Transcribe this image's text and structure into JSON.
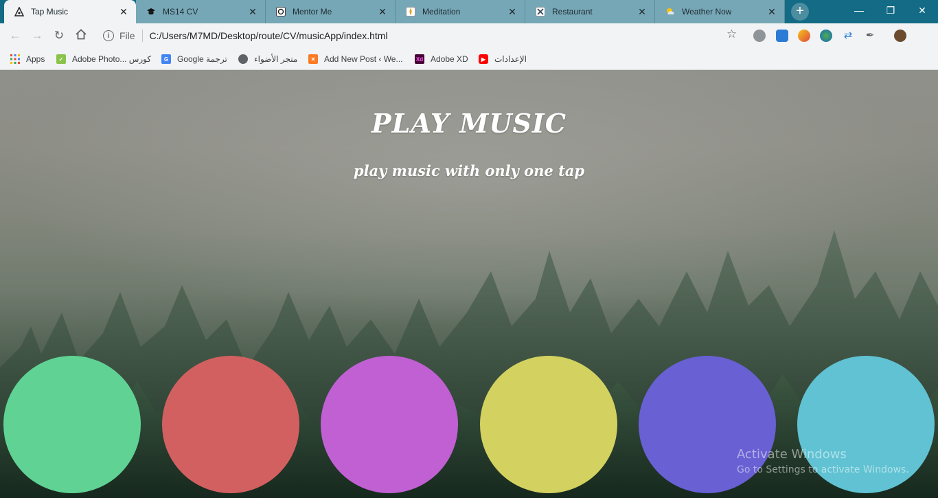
{
  "browser": {
    "tabs": [
      {
        "label": "Tap Music",
        "active": true,
        "icon": "music-app-icon"
      },
      {
        "label": "MS14 CV",
        "active": false,
        "icon": "graduation-cap-icon"
      },
      {
        "label": "Mentor Me",
        "active": false,
        "icon": "mentor-logo-icon"
      },
      {
        "label": "Meditation",
        "active": false,
        "icon": "meditation-icon"
      },
      {
        "label": "Restaurant",
        "active": false,
        "icon": "restaurant-icon"
      },
      {
        "label": "Weather Now",
        "active": false,
        "icon": "weather-icon"
      }
    ],
    "url_scheme": "File",
    "url": "C:/Users/M7MD/Desktop/route/CV/musicApp/index.html"
  },
  "bookmarks": [
    {
      "label": "Apps",
      "icon": "apps-grid-icon",
      "color": "#e8453c"
    },
    {
      "label": "Adobe Photo... كورس",
      "icon": "adobe-photoshop-icon",
      "color": "#8bc34a"
    },
    {
      "label": "Google ترجمة",
      "icon": "google-translate-icon",
      "color": "#4285f4"
    },
    {
      "label": "متجر الأضواء",
      "icon": "globe-icon",
      "color": "#5f6368"
    },
    {
      "label": "Add New Post ‹ We...",
      "icon": "xampp-icon",
      "color": "#fb7a24"
    },
    {
      "label": "Adobe XD",
      "icon": "adobe-xd-icon",
      "color": "#470137"
    },
    {
      "label": "الإعدادات",
      "icon": "youtube-icon",
      "color": "#ff0000"
    }
  ],
  "page": {
    "title": "PLAY MUSIC",
    "subtitle": "play music with only one tap",
    "pads": [
      {
        "color": "#60d394"
      },
      {
        "color": "#d36060"
      },
      {
        "color": "#c060d3"
      },
      {
        "color": "#d3d160"
      },
      {
        "color": "#6860d3"
      },
      {
        "color": "#60c2d3"
      }
    ]
  },
  "watermark": {
    "line1": "Activate Windows",
    "line2": "Go to Settings to activate Windows."
  }
}
